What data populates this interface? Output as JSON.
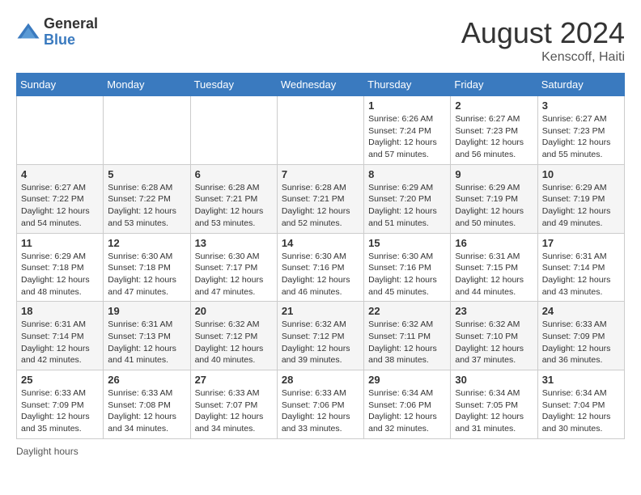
{
  "header": {
    "logo_general": "General",
    "logo_blue": "Blue",
    "month_year": "August 2024",
    "location": "Kenscoff, Haiti"
  },
  "footer": {
    "daylight_label": "Daylight hours"
  },
  "weekdays": [
    "Sunday",
    "Monday",
    "Tuesday",
    "Wednesday",
    "Thursday",
    "Friday",
    "Saturday"
  ],
  "weeks": [
    [
      {
        "date": "",
        "info": ""
      },
      {
        "date": "",
        "info": ""
      },
      {
        "date": "",
        "info": ""
      },
      {
        "date": "",
        "info": ""
      },
      {
        "date": "1",
        "info": "Sunrise: 6:26 AM\nSunset: 7:24 PM\nDaylight: 12 hours\nand 57 minutes."
      },
      {
        "date": "2",
        "info": "Sunrise: 6:27 AM\nSunset: 7:23 PM\nDaylight: 12 hours\nand 56 minutes."
      },
      {
        "date": "3",
        "info": "Sunrise: 6:27 AM\nSunset: 7:23 PM\nDaylight: 12 hours\nand 55 minutes."
      }
    ],
    [
      {
        "date": "4",
        "info": "Sunrise: 6:27 AM\nSunset: 7:22 PM\nDaylight: 12 hours\nand 54 minutes."
      },
      {
        "date": "5",
        "info": "Sunrise: 6:28 AM\nSunset: 7:22 PM\nDaylight: 12 hours\nand 53 minutes."
      },
      {
        "date": "6",
        "info": "Sunrise: 6:28 AM\nSunset: 7:21 PM\nDaylight: 12 hours\nand 53 minutes."
      },
      {
        "date": "7",
        "info": "Sunrise: 6:28 AM\nSunset: 7:21 PM\nDaylight: 12 hours\nand 52 minutes."
      },
      {
        "date": "8",
        "info": "Sunrise: 6:29 AM\nSunset: 7:20 PM\nDaylight: 12 hours\nand 51 minutes."
      },
      {
        "date": "9",
        "info": "Sunrise: 6:29 AM\nSunset: 7:19 PM\nDaylight: 12 hours\nand 50 minutes."
      },
      {
        "date": "10",
        "info": "Sunrise: 6:29 AM\nSunset: 7:19 PM\nDaylight: 12 hours\nand 49 minutes."
      }
    ],
    [
      {
        "date": "11",
        "info": "Sunrise: 6:29 AM\nSunset: 7:18 PM\nDaylight: 12 hours\nand 48 minutes."
      },
      {
        "date": "12",
        "info": "Sunrise: 6:30 AM\nSunset: 7:18 PM\nDaylight: 12 hours\nand 47 minutes."
      },
      {
        "date": "13",
        "info": "Sunrise: 6:30 AM\nSunset: 7:17 PM\nDaylight: 12 hours\nand 47 minutes."
      },
      {
        "date": "14",
        "info": "Sunrise: 6:30 AM\nSunset: 7:16 PM\nDaylight: 12 hours\nand 46 minutes."
      },
      {
        "date": "15",
        "info": "Sunrise: 6:30 AM\nSunset: 7:16 PM\nDaylight: 12 hours\nand 45 minutes."
      },
      {
        "date": "16",
        "info": "Sunrise: 6:31 AM\nSunset: 7:15 PM\nDaylight: 12 hours\nand 44 minutes."
      },
      {
        "date": "17",
        "info": "Sunrise: 6:31 AM\nSunset: 7:14 PM\nDaylight: 12 hours\nand 43 minutes."
      }
    ],
    [
      {
        "date": "18",
        "info": "Sunrise: 6:31 AM\nSunset: 7:14 PM\nDaylight: 12 hours\nand 42 minutes."
      },
      {
        "date": "19",
        "info": "Sunrise: 6:31 AM\nSunset: 7:13 PM\nDaylight: 12 hours\nand 41 minutes."
      },
      {
        "date": "20",
        "info": "Sunrise: 6:32 AM\nSunset: 7:12 PM\nDaylight: 12 hours\nand 40 minutes."
      },
      {
        "date": "21",
        "info": "Sunrise: 6:32 AM\nSunset: 7:12 PM\nDaylight: 12 hours\nand 39 minutes."
      },
      {
        "date": "22",
        "info": "Sunrise: 6:32 AM\nSunset: 7:11 PM\nDaylight: 12 hours\nand 38 minutes."
      },
      {
        "date": "23",
        "info": "Sunrise: 6:32 AM\nSunset: 7:10 PM\nDaylight: 12 hours\nand 37 minutes."
      },
      {
        "date": "24",
        "info": "Sunrise: 6:33 AM\nSunset: 7:09 PM\nDaylight: 12 hours\nand 36 minutes."
      }
    ],
    [
      {
        "date": "25",
        "info": "Sunrise: 6:33 AM\nSunset: 7:09 PM\nDaylight: 12 hours\nand 35 minutes."
      },
      {
        "date": "26",
        "info": "Sunrise: 6:33 AM\nSunset: 7:08 PM\nDaylight: 12 hours\nand 34 minutes."
      },
      {
        "date": "27",
        "info": "Sunrise: 6:33 AM\nSunset: 7:07 PM\nDaylight: 12 hours\nand 34 minutes."
      },
      {
        "date": "28",
        "info": "Sunrise: 6:33 AM\nSunset: 7:06 PM\nDaylight: 12 hours\nand 33 minutes."
      },
      {
        "date": "29",
        "info": "Sunrise: 6:34 AM\nSunset: 7:06 PM\nDaylight: 12 hours\nand 32 minutes."
      },
      {
        "date": "30",
        "info": "Sunrise: 6:34 AM\nSunset: 7:05 PM\nDaylight: 12 hours\nand 31 minutes."
      },
      {
        "date": "31",
        "info": "Sunrise: 6:34 AM\nSunset: 7:04 PM\nDaylight: 12 hours\nand 30 minutes."
      }
    ]
  ]
}
